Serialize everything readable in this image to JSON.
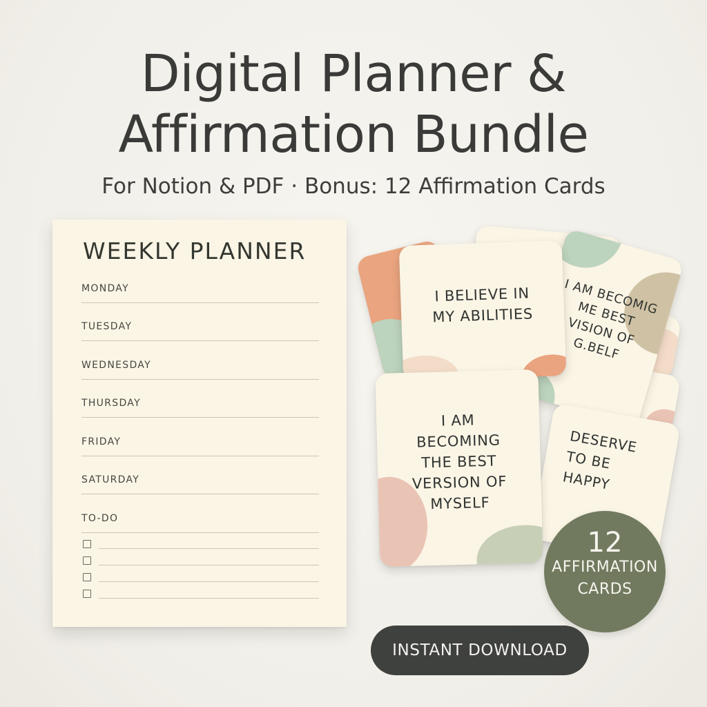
{
  "title": {
    "line1": "Digital Planner &",
    "line2": "Affirmation Bundle"
  },
  "subtitle": "For Notion & PDF · Bonus: 12 Affirmation Cards",
  "planner": {
    "title": "WEEKLY PLANNER",
    "days": [
      "MONDAY",
      "TUESDAY",
      "WEDNESDAY",
      "THURSDAY",
      "FRIDAY",
      "SATURDAY"
    ],
    "todo_label": "TO-DO",
    "todo_item_count": 4
  },
  "cards": {
    "card1": "I BELIEVE IN MY ABILITIES",
    "card2": "I AM BECOMIG ME BEST VISION OF G.BELF",
    "card3": "I AM BECOMING THE BEST VERSION OF MYSELF",
    "card4": "DESERVE TO BE HAPPY"
  },
  "badge": {
    "number": "12",
    "text_line1": "AFFIRMATION",
    "text_line2": "CARDS"
  },
  "cta": {
    "label": "INSTANT DOWNLOAD"
  },
  "colors": {
    "background": "#f4f2ed",
    "text_dark": "#3a3a38",
    "paper": "#fbf5e6",
    "sage": "#717a5e",
    "peach": "#eaa47f",
    "mint": "#bcd3bd",
    "tan": "#cfc2a4",
    "blush": "#e9c4b4",
    "button": "#3f413e"
  }
}
